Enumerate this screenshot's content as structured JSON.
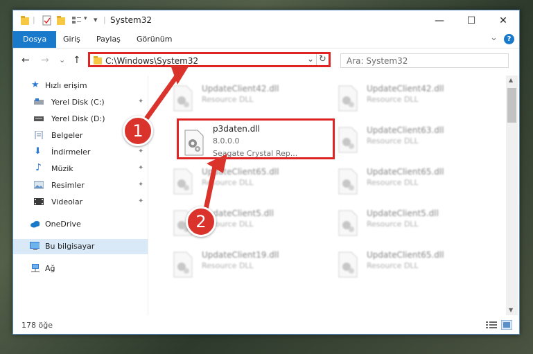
{
  "window": {
    "title": "System32",
    "minimize_glyph": "—",
    "maximize_glyph": "☐",
    "close_glyph": "✕"
  },
  "ribbon": {
    "tabs": [
      "Dosya",
      "Giriş",
      "Paylaş",
      "Görünüm"
    ],
    "expand_glyph": "⌄",
    "help_glyph": "?"
  },
  "nav": {
    "back_glyph": "←",
    "forward_glyph": "→",
    "recent_glyph": "⌄",
    "up_glyph": "↑",
    "address": "C:\\Windows\\System32",
    "address_dropdown_glyph": "⌄",
    "refresh_glyph": "↻",
    "search_placeholder": "Ara: System32"
  },
  "sidebar": {
    "items": [
      {
        "label": "Hızlı erişim",
        "icon": "star-icon",
        "pinned": false
      },
      {
        "label": "Yerel Disk (C:)",
        "icon": "drive-icon",
        "pinned": true
      },
      {
        "label": "Yerel Disk (D:)",
        "icon": "drive-icon",
        "pinned": false
      },
      {
        "label": "Belgeler",
        "icon": "documents-icon",
        "pinned": true
      },
      {
        "label": "İndirmeler",
        "icon": "download-icon",
        "pinned": true
      },
      {
        "label": "Müzik",
        "icon": "music-icon",
        "pinned": true
      },
      {
        "label": "Resimler",
        "icon": "pictures-icon",
        "pinned": true
      },
      {
        "label": "Videolar",
        "icon": "videos-icon",
        "pinned": true
      },
      {
        "label": "OneDrive",
        "icon": "onedrive-icon",
        "pinned": false
      },
      {
        "label": "Bu bilgisayar",
        "icon": "computer-icon",
        "pinned": false,
        "selected": true
      },
      {
        "label": "Ağ",
        "icon": "network-icon",
        "pinned": false
      }
    ],
    "pin_glyph": "📌"
  },
  "files": {
    "highlighted": {
      "name": "p3daten.dll",
      "version": "8.0.0.0",
      "description": "Seagate Crystal Rep..."
    },
    "background": [
      {
        "name": "UpdateClient42.dll",
        "description": "Resource DLL"
      },
      {
        "name": "UpdateClient42.dll",
        "description": "Resource DLL"
      },
      {
        "name": "UpdateClient63.dll",
        "description": "Resource DLL"
      },
      {
        "name": "UpdateClient65.dll",
        "description": "Resource DLL"
      },
      {
        "name": "UpdateClient65.dll",
        "description": "Resource DLL"
      },
      {
        "name": "UpdateClient5.dll",
        "description": "Resource DLL"
      },
      {
        "name": "UpdateClient5.dll",
        "description": "Resource DLL"
      },
      {
        "name": "UpdateClient19.dll",
        "description": "Resource DLL"
      },
      {
        "name": "UpdateClient65.dll",
        "description": "Resource DLL"
      }
    ]
  },
  "status": {
    "item_count": "178 öğe"
  },
  "callouts": {
    "one": "1",
    "two": "2",
    "color": "#d9332b"
  }
}
